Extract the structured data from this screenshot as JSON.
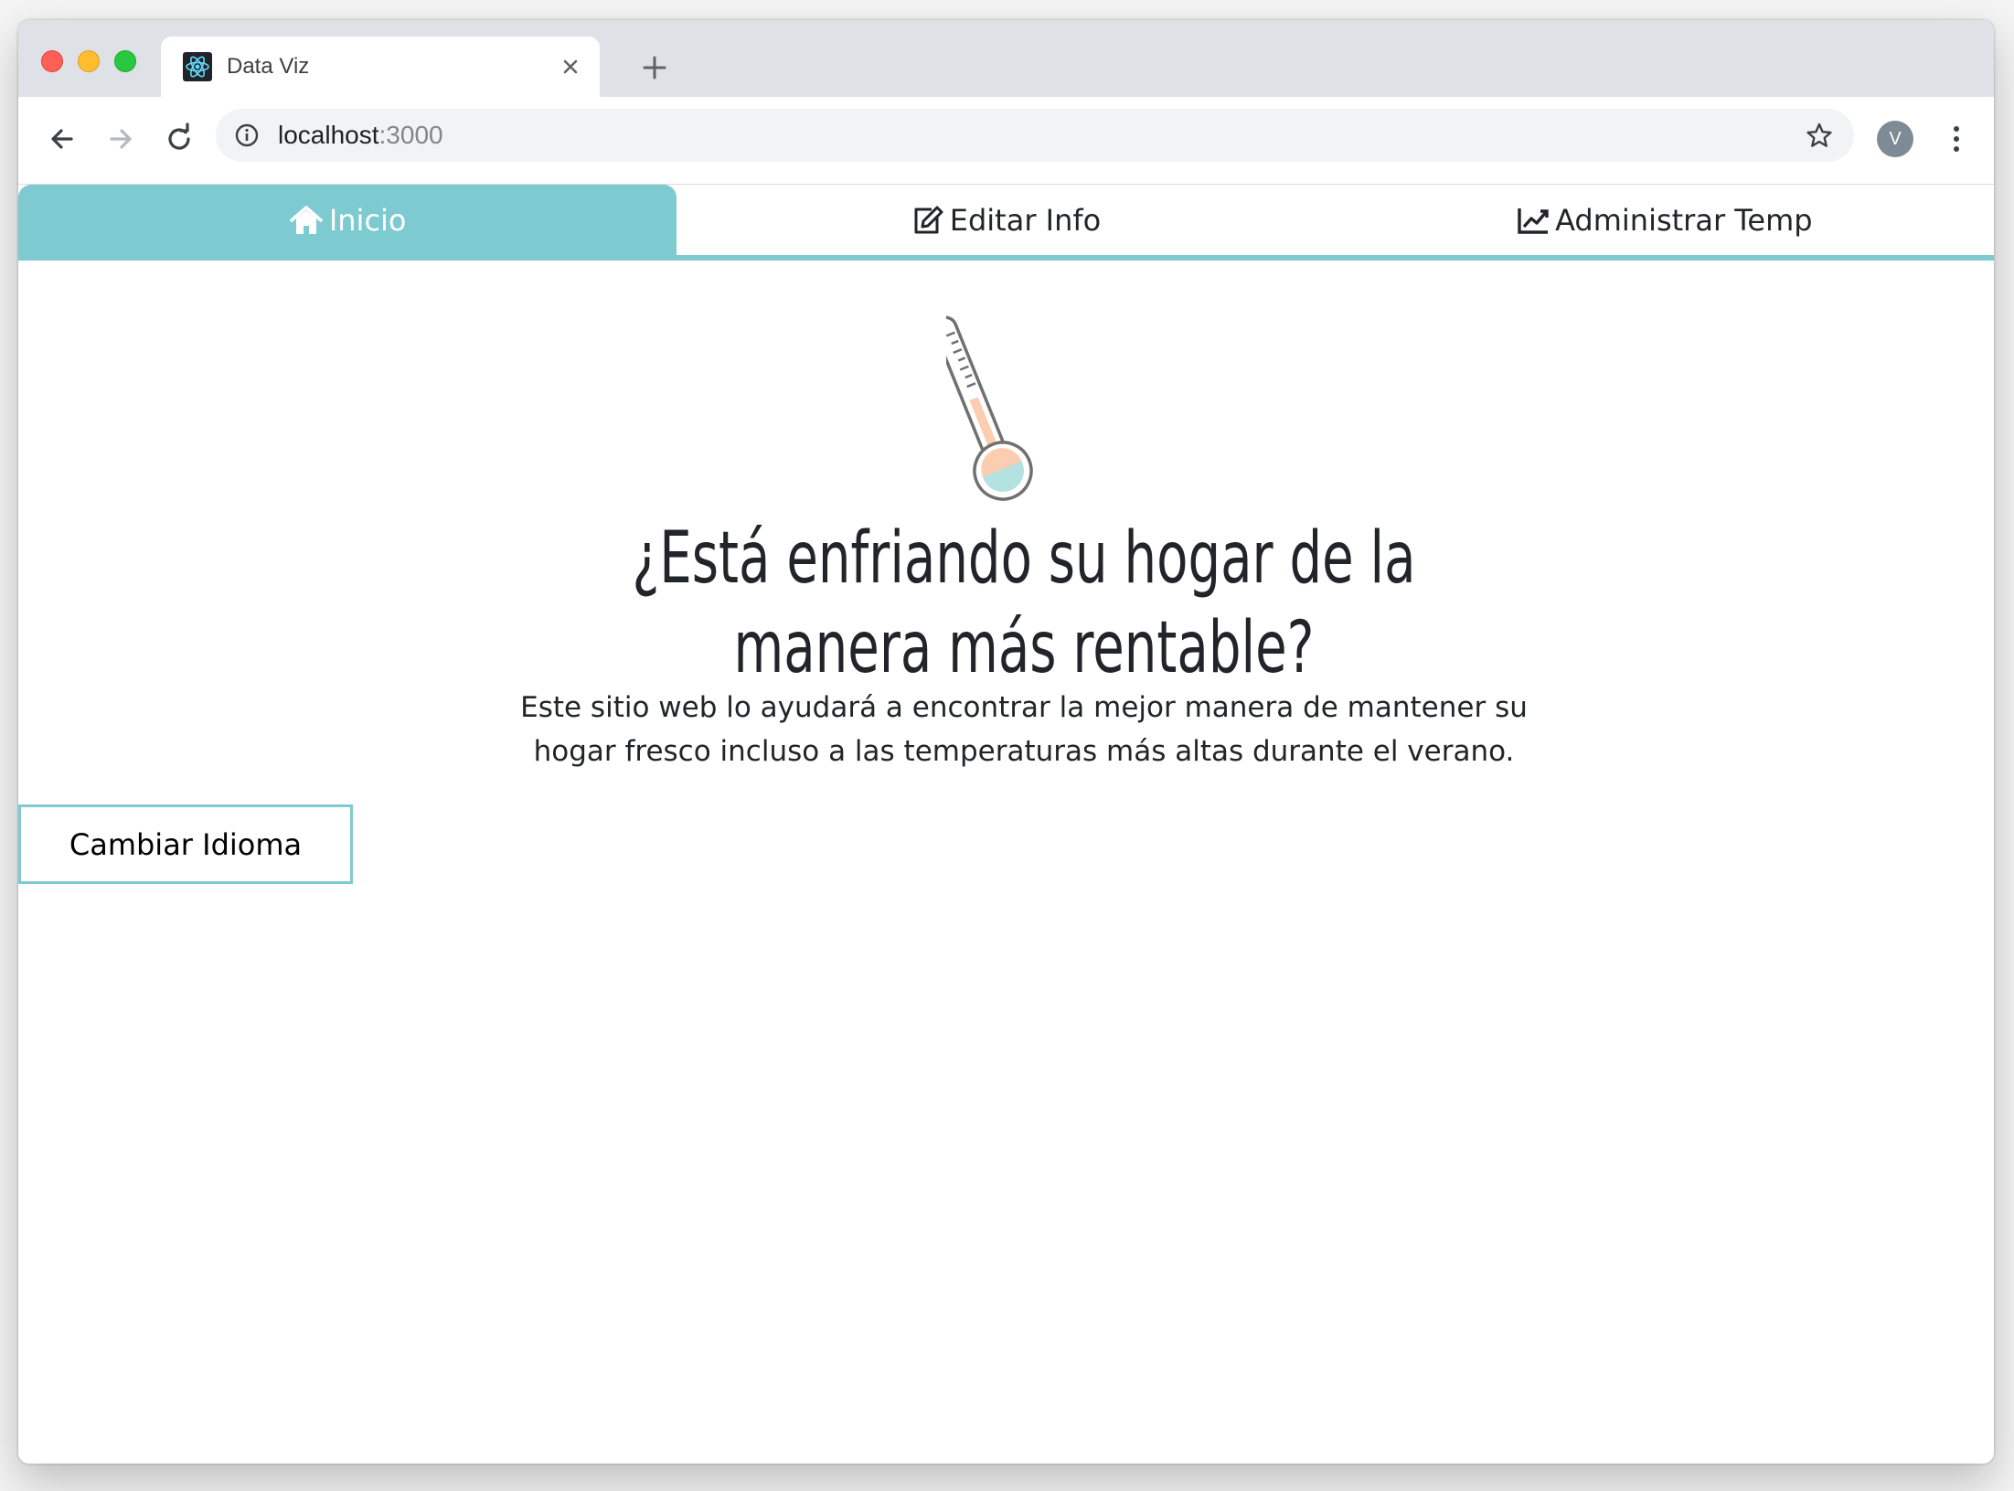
{
  "browser": {
    "tab_title": "Data Viz",
    "url_host": "localhost",
    "url_port": ":3000",
    "profile_initial": "V"
  },
  "nav": {
    "items": [
      {
        "label": "Inicio",
        "icon": "home-icon",
        "active": true
      },
      {
        "label": "Editar Info",
        "icon": "edit-icon",
        "active": false
      },
      {
        "label": "Administrar Temp",
        "icon": "line-chart-icon",
        "active": false
      }
    ]
  },
  "hero": {
    "illustration": "thermometer-icon",
    "title": "¿Está enfriando su hogar de la manera más rentable?",
    "description": "Este sitio web lo ayudará a encontrar la mejor manera de mantener su hogar fresco incluso a las temperaturas más altas durante el verano."
  },
  "actions": {
    "change_language": "Cambiar Idioma"
  },
  "colors": {
    "accent": "#7ecad1",
    "text": "#212529",
    "chrome_bg": "#dee1e6"
  }
}
